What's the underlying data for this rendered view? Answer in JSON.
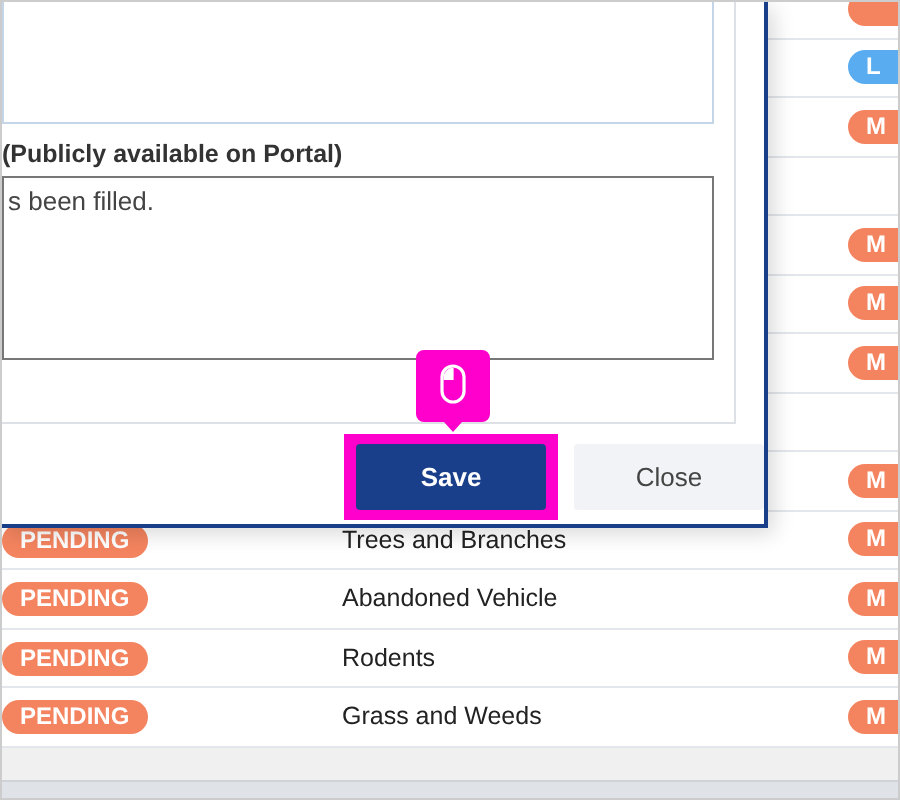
{
  "table": {
    "rows": [
      {
        "priority": {
          "color": "#f4845f"
        }
      },
      {
        "priority": {
          "label": "L",
          "color": "#5aacf0"
        }
      },
      {
        "priority": {
          "label": "M",
          "color": "#f4845f"
        }
      },
      {},
      {
        "priority": {
          "label": "M",
          "color": "#f4845f"
        }
      },
      {
        "priority": {
          "label": "M",
          "color": "#f4845f"
        }
      },
      {
        "priority": {
          "label": "M",
          "color": "#f4845f"
        }
      },
      {},
      {
        "priority": {
          "label": "M",
          "color": "#f4845f"
        }
      },
      {
        "status": {
          "label": "PENDING",
          "color": "#f4845f"
        },
        "category": "Trees and Branches",
        "priority": {
          "label": "M",
          "color": "#f4845f"
        }
      },
      {
        "status": {
          "label": "PENDING",
          "color": "#f4845f"
        },
        "category": "Abandoned Vehicle",
        "priority": {
          "label": "M",
          "color": "#f4845f"
        }
      },
      {
        "status": {
          "label": "PENDING",
          "color": "#f4845f"
        },
        "category": "Rodents",
        "priority": {
          "label": "M",
          "color": "#f4845f"
        }
      },
      {
        "status": {
          "label": "PENDING",
          "color": "#f4845f"
        },
        "category": "Grass and Weeds",
        "priority": {
          "label": "M",
          "color": "#f4845f"
        }
      }
    ]
  },
  "dialog": {
    "public_note": {
      "label": "(Publicly available on Portal)",
      "value": "s been filled."
    },
    "buttons": [
      {
        "label": "Save",
        "kind": "primary",
        "highlighted": true
      },
      {
        "label": "Close",
        "kind": "secondary",
        "highlighted": false
      }
    ]
  }
}
